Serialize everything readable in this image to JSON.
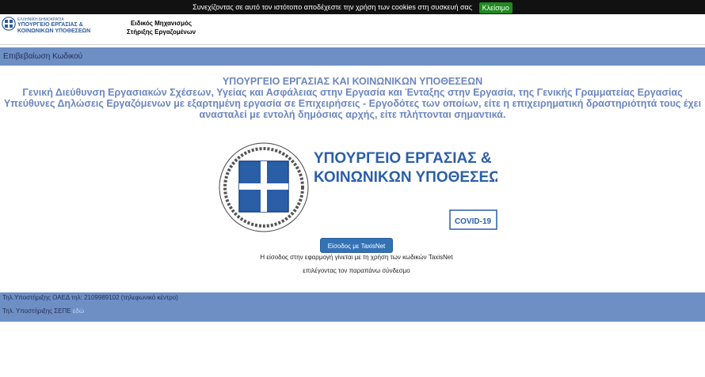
{
  "cookie": {
    "message": "Συνεχίζοντας σε αυτό τον ιστότοπο αποδέχεστε την χρήση των cookies στη συσκευή σας",
    "close_label": "Κλείσιμο"
  },
  "header": {
    "logo_top": "ΕΛΛΗΝΙΚΗ ΔΗΜΟΚΡΑΤΙΑ",
    "logo_line1": "ΥΠΟΥΡΓΕΙΟ ΕΡΓΑΣΙΑΣ &",
    "logo_line2": "ΚΟΙΝΩΝΙΚΩΝ ΥΠΟΘΕΣΕΩΝ",
    "mechanism_line1": "Ειδικός Μηχανισμός",
    "mechanism_line2": "Στήριξης Εργαζομένων"
  },
  "verify_bar": {
    "label": "Επιβεβαίωση Κωδικού"
  },
  "titles": {
    "ministry": "ΥΠΟΥΡΓΕΙΟ ΕΡΓΑΣΙΑΣ ΚΑΙ ΚΟΙΝΩΝΙΚΩΝ ΥΠΟΘΕΣΕΩΝ",
    "directorate": "Γενική Διεύθυνση Εργασιακών Σχέσεων, Υγείας και Ασφάλειας στην Εργασία και Ένταξης στην Εργασία, της Γενικής Γραμματείας Εργασίας",
    "declarations": "Υπεύθυνες Δηλώσεις Εργαζόμενων με εξαρτημένη εργασία σε Επιχειρήσεις - Εργοδότες των οποίων, είτε η επιχειρηματική δραστηριότητά τους έχει ανασταλεί με εντολή δημόσιας αρχής, είτε πλήττονται σημαντικά."
  },
  "banner": {
    "line1": "ΥΠΟΥΡΓΕΙΟ ΕΡΓΑΣΙΑΣ &",
    "line2": "ΚΟΙΝΩΝΙΚΩΝ ΥΠΟΘΕΣΕΩΝ",
    "badge": "COVID-19"
  },
  "login": {
    "button_label": "Είσοδος με TaxisNet",
    "info_line1": "Η είσοδος στην εφαρμογή γίνεται με τη χρήση των κωδικών TaxisNet",
    "info_line2": "επιλέγοντας τον παραπάνω σύνδεσμο"
  },
  "footer": {
    "oaed_support": "Τηλ.Υποστήριξης ΟΑΕΔ τηλ: 2109989102 (τηλεφωνικό κέντρο)",
    "sepe_label": "Τηλ. Υποστήριξης ΣΕΠΕ",
    "sepe_link": "εδώ"
  },
  "colors": {
    "bar_blue": "#6e8fc4",
    "title_blue": "#6b86c0",
    "emblem_blue": "#2a5fa8",
    "button_blue": "#3372b5",
    "cookie_green": "#1f8a1f"
  }
}
